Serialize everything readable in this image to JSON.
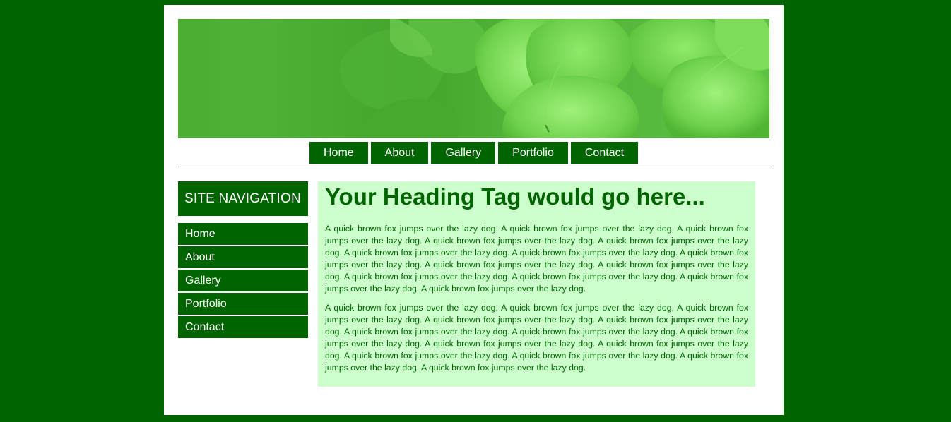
{
  "top_nav": [
    "Home",
    "About",
    "Gallery",
    "Portfolio",
    "Contact"
  ],
  "sidebar": {
    "title": "SITE NAVIGATION",
    "items": [
      "Home",
      "About",
      "Gallery",
      "Portfolio",
      "Contact"
    ]
  },
  "content": {
    "heading": "Your Heading Tag would go here...",
    "paragraphs": [
      "A quick brown fox jumps over the lazy dog. A quick brown fox jumps over the lazy dog. A quick brown fox jumps over the lazy dog. A quick brown fox jumps over the lazy dog. A quick brown fox jumps over the lazy dog. A quick brown fox jumps over the lazy dog. A quick brown fox jumps over the lazy dog. A quick brown fox jumps over the lazy dog. A quick brown fox jumps over the lazy dog. A quick brown fox jumps over the lazy dog. A quick brown fox jumps over the lazy dog. A quick brown fox jumps over the lazy dog. A quick brown fox jumps over the lazy dog. A quick brown fox jumps over the lazy dog.",
      "A quick brown fox jumps over the lazy dog. A quick brown fox jumps over the lazy dog. A quick brown fox jumps over the lazy dog. A quick brown fox jumps over the lazy dog. A quick brown fox jumps over the lazy dog. A quick brown fox jumps over the lazy dog. A quick brown fox jumps over the lazy dog. A quick brown fox jumps over the lazy dog. A quick brown fox jumps over the lazy dog. A quick brown fox jumps over the lazy dog. A quick brown fox jumps over the lazy dog. A quick brown fox jumps over the lazy dog. A quick brown fox jumps over the lazy dog. A quick brown fox jumps over the lazy dog."
    ]
  },
  "colors": {
    "page_background": "#006400",
    "nav_background": "#006400",
    "content_background": "#ccffcc",
    "text": "#006400"
  }
}
